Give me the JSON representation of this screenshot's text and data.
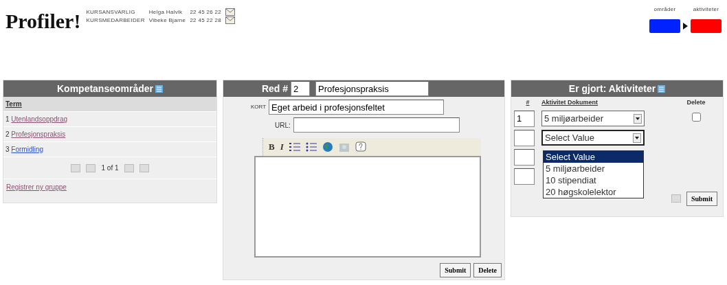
{
  "header": {
    "logo": "Profiler!",
    "contacts": [
      {
        "role": "KURSANSVARLIG",
        "name": "Helga Halvik",
        "phone": "22 45 26 22"
      },
      {
        "role": "KURSMEDARBEIDER",
        "name": "Vibeke Bjarne",
        "phone": "22 45 22 28"
      }
    ],
    "legend": [
      {
        "label": "områder",
        "color": "#0022ff"
      },
      {
        "label": "aktiviteter",
        "color": "#ff0000"
      }
    ]
  },
  "left": {
    "title": "Kompetanseområder",
    "column": "Term",
    "terms": [
      {
        "number": "1",
        "label": "Utenlandsoppdrag",
        "visited": true
      },
      {
        "number": "2",
        "label": "Profesjonspraksis",
        "visited": true
      },
      {
        "number": "3",
        "label": "Formidling",
        "visited": false
      }
    ],
    "pager": "1 of 1",
    "link": "Registrer ny gruppe"
  },
  "middle": {
    "title": "Red #",
    "number": "2",
    "name": "Profesjonspraksis",
    "fields": [
      {
        "label": "KORT",
        "value": "Eget arbeid i profesjonsfeltet"
      },
      {
        "label": "URL:"
      }
    ],
    "format_buttons": [
      "B",
      "I"
    ],
    "buttons": [
      "Submit",
      "Delete"
    ]
  },
  "right": {
    "title": "Er gjort: Aktiviteter",
    "columns": [
      "#",
      "Aktivitet Dokument",
      "Delete"
    ],
    "rows": [
      {
        "kind": "filled",
        "number": "1",
        "value": "5 miljøarbeider",
        "checked": false
      },
      {
        "kind": "select",
        "value": "Select Value",
        "expanded": true,
        "options": [
          {
            "label": "Select Value",
            "selected": true
          },
          {
            "label": "5 miljøarbeider",
            "selected": false
          },
          {
            "label": "10 stipendiat",
            "selected": false
          },
          {
            "label": "20 høgskolelektor",
            "selected": false
          }
        ]
      },
      {
        "kind": "empty"
      },
      {
        "kind": "empty"
      }
    ],
    "button": "Submit"
  }
}
